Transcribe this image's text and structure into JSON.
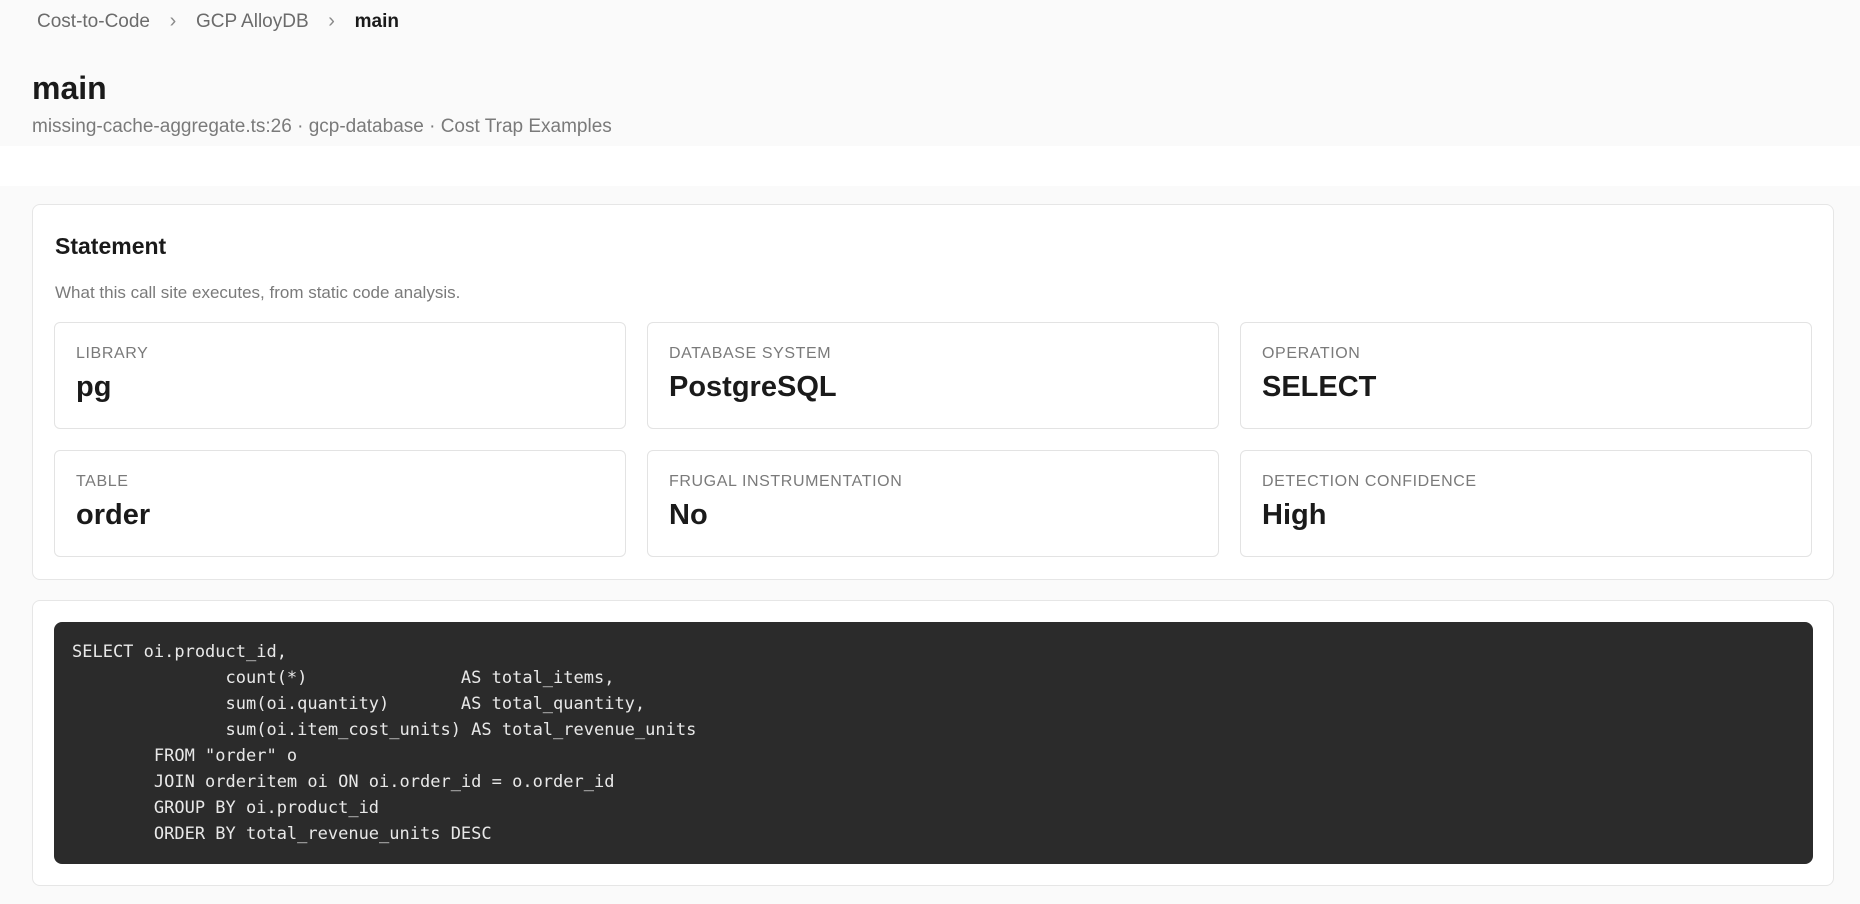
{
  "breadcrumb": {
    "items": [
      "Cost-to-Code",
      "GCP AlloyDB",
      "main"
    ],
    "separator": "›"
  },
  "header": {
    "title": "main",
    "subtitle": "missing-cache-aggregate.ts:26 · gcp-database · Cost Trap Examples"
  },
  "statement": {
    "title": "Statement",
    "description": "What this call site executes, from static code analysis.",
    "stats": [
      {
        "label": "LIBRARY",
        "value": "pg"
      },
      {
        "label": "DATABASE SYSTEM",
        "value": "PostgreSQL"
      },
      {
        "label": "OPERATION",
        "value": "SELECT"
      },
      {
        "label": "TABLE",
        "value": "order"
      },
      {
        "label": "FRUGAL INSTRUMENTATION",
        "value": "No"
      },
      {
        "label": "DETECTION CONFIDENCE",
        "value": "High"
      }
    ]
  },
  "code": {
    "sql": "SELECT oi.product_id,\n               count(*)               AS total_items,\n               sum(oi.quantity)       AS total_quantity,\n               sum(oi.item_cost_units) AS total_revenue_units\n        FROM \"order\" o\n        JOIN orderitem oi ON oi.order_id = o.order_id\n        GROUP BY oi.product_id\n        ORDER BY total_revenue_units DESC"
  }
}
